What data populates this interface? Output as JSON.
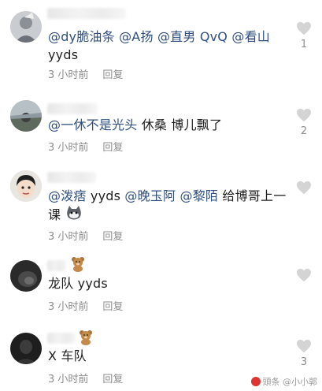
{
  "comments": [
    {
      "text": "@dy脆油条 @A扬 @直男 QvQ @看山",
      "text2": "yyds",
      "time": "3 小时前",
      "reply": "回复",
      "likes": "1",
      "likes_color": "#8d8d8d"
    },
    {
      "text": "@一休不是光头 休桑 博儿飘了",
      "time": "3 小时前",
      "reply": "回复",
      "likes": "2"
    },
    {
      "text": "@泼痞 yyds @晚玉阿 @黎陌 给博哥上一",
      "text2": "课",
      "time": "3 小时前",
      "reply": "回复",
      "likes": ""
    },
    {
      "text": "龙队 yyds",
      "time": "3 小时前",
      "reply": "回复",
      "likes": ""
    },
    {
      "text": "X 车队",
      "time": "3 小时前",
      "reply": "回复",
      "likes": "3"
    }
  ],
  "watermark": "頭条 @小小郭",
  "icons": {
    "like": "heart-icon",
    "badge": "teddy-bear-icon",
    "sticker": "cat-face-sticker"
  }
}
